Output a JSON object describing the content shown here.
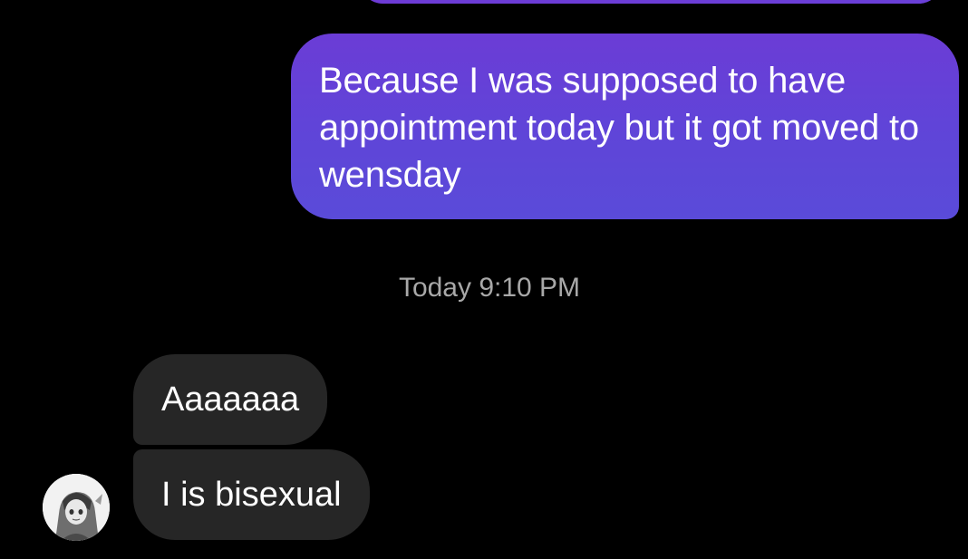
{
  "thread": {
    "outgoing_message": "Because I was supposed to have appointment today but it got moved to wensday",
    "timestamp": "Today 9:10 PM",
    "incoming_messages": [
      {
        "text": "Aaaaaaa"
      },
      {
        "text": "I is bisexual"
      }
    ]
  },
  "colors": {
    "background": "#000000",
    "outgoing_bubble": "#6b3cd6",
    "incoming_bubble": "#262626",
    "timestamp_text": "#a8a8a8"
  },
  "icons": {
    "avatar": "contact-avatar"
  }
}
